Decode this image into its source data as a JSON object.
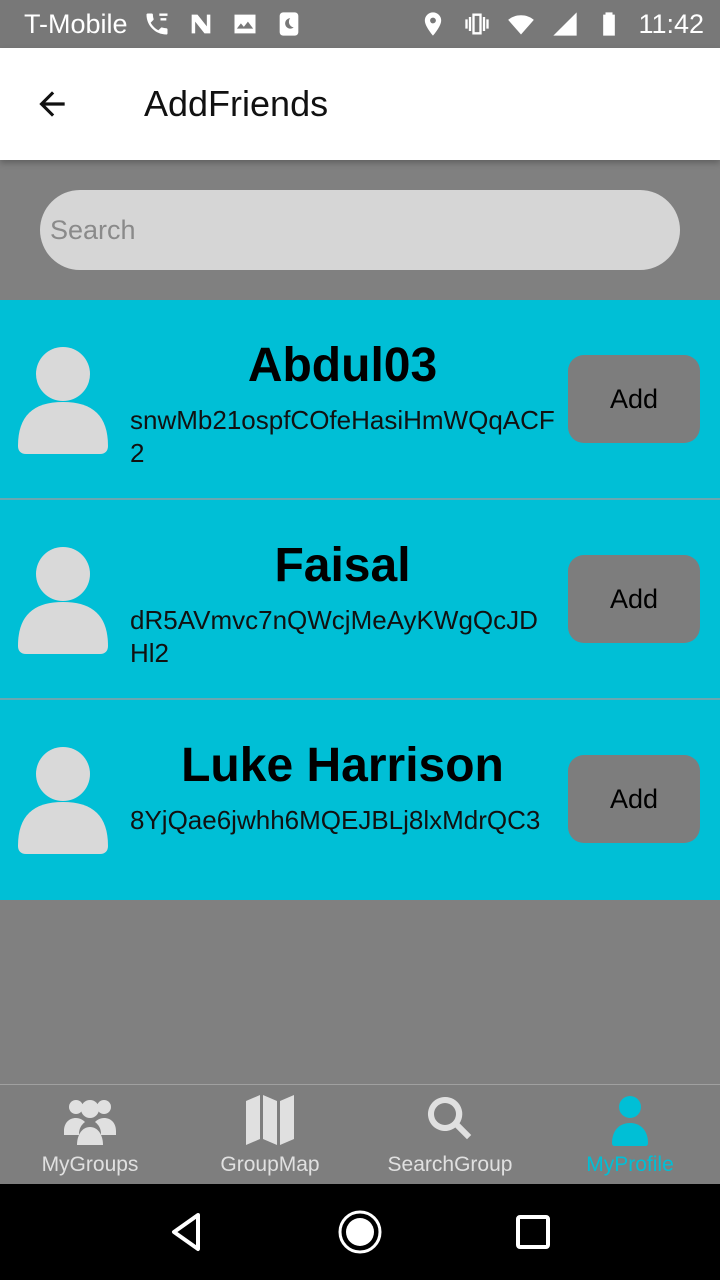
{
  "status_bar": {
    "carrier": "T-Mobile",
    "time": "11:42",
    "left_icons": [
      "wifi-calling-icon",
      "nfc-icon",
      "image-icon",
      "moon-icon"
    ],
    "right_icons": [
      "location-icon",
      "vibrate-icon",
      "wifi-icon",
      "signal-icon",
      "battery-icon"
    ]
  },
  "app_bar": {
    "title": "AddFriends",
    "back_icon": "arrow-left-icon"
  },
  "search": {
    "placeholder": "Search",
    "value": ""
  },
  "friends": [
    {
      "name": "Abdul03",
      "id": "snwMb21ospfCOfeHasiHmWQqACF2",
      "button_label": "Add"
    },
    {
      "name": "Faisal",
      "id": "dR5AVmvc7nQWcjMeAyKWgQcJDHl2",
      "button_label": "Add"
    },
    {
      "name": "Luke Harrison",
      "id": "8YjQae6jwhh6MQEJBLj8lxMdrQC3",
      "button_label": "Add"
    }
  ],
  "bottom_nav": {
    "items": [
      {
        "label": "MyGroups",
        "icon": "group-icon",
        "active": false
      },
      {
        "label": "GroupMap",
        "icon": "map-icon",
        "active": false
      },
      {
        "label": "SearchGroup",
        "icon": "search-icon",
        "active": false
      },
      {
        "label": "MyProfile",
        "icon": "user-icon",
        "active": true
      }
    ]
  },
  "colors": {
    "accent": "#00bfd6",
    "background": "#808080",
    "row_background": "#00bfd6",
    "button_background": "#7d7d7d"
  }
}
